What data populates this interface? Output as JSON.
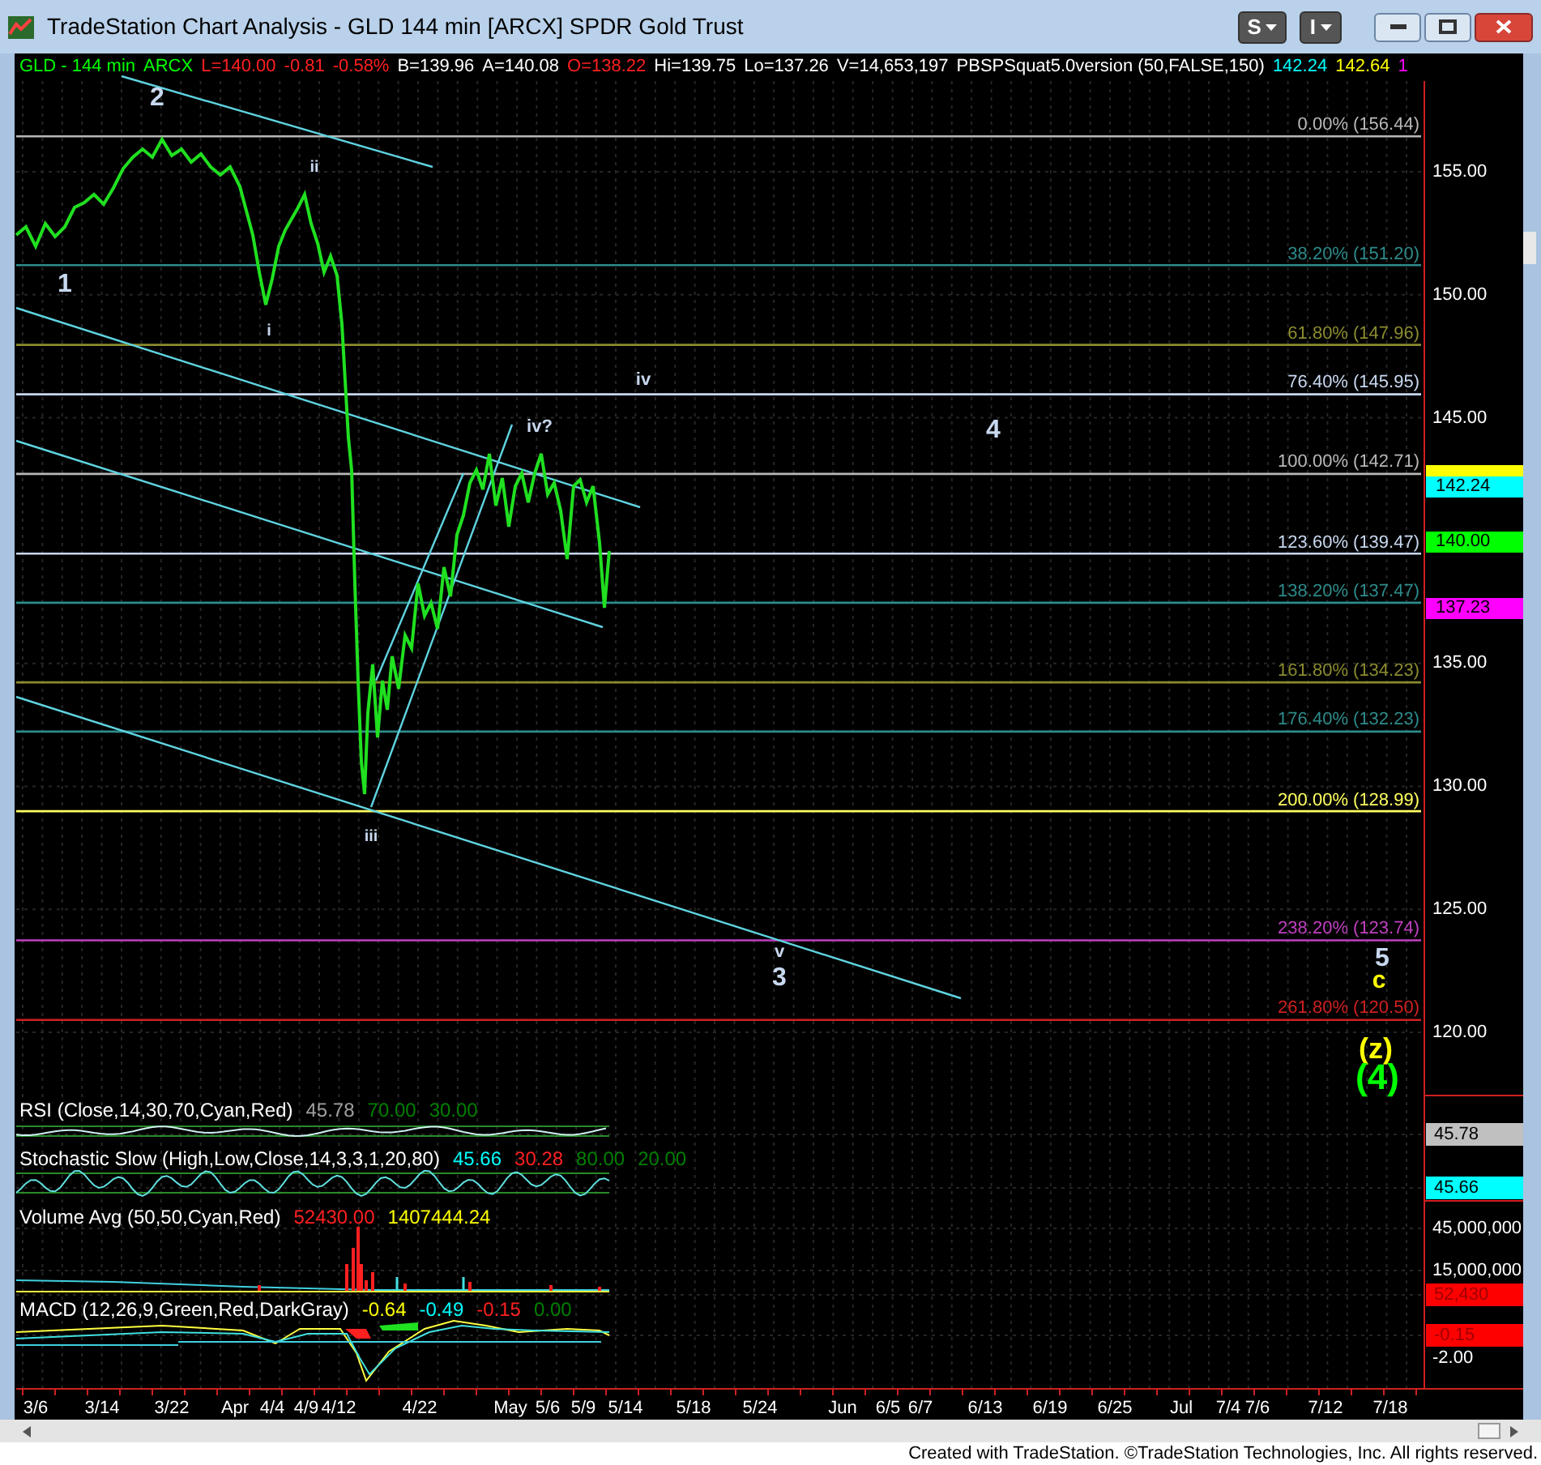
{
  "window": {
    "title": "TradeStation Chart Analysis - GLD 144 min [ARCX] SPDR Gold Trust"
  },
  "toolbar_buttons": [
    {
      "label": "S"
    },
    {
      "label": "I"
    }
  ],
  "header": [
    {
      "text": "GLD - 144 min",
      "color": "#00ff00"
    },
    {
      "text": "ARCX",
      "color": "#00ff00"
    },
    {
      "text": "L=140.00",
      "color": "#ff2020"
    },
    {
      "text": "-0.81",
      "color": "#ff2020"
    },
    {
      "text": "-0.58%",
      "color": "#ff2020"
    },
    {
      "text": "B=139.96",
      "color": "#ffffff"
    },
    {
      "text": "A=140.08",
      "color": "#ffffff"
    },
    {
      "text": "O=138.22",
      "color": "#ff2020"
    },
    {
      "text": "Hi=139.75",
      "color": "#ffffff"
    },
    {
      "text": "Lo=137.26",
      "color": "#ffffff"
    },
    {
      "text": "V=14,653,197",
      "color": "#ffffff"
    },
    {
      "text": "PBSPSquat5.0version (50,FALSE,150)",
      "color": "#ffffff"
    },
    {
      "text": "142.24",
      "color": "#00ffff"
    },
    {
      "text": "142.64",
      "color": "#ffff00"
    },
    {
      "text": "1",
      "color": "#ff00ff"
    }
  ],
  "fib_levels": [
    {
      "label": "0.00% (156.44)",
      "color": "#b8b8b8"
    },
    {
      "label": "38.20% (151.20)",
      "color": "#2e8b8b"
    },
    {
      "label": "61.80% (147.96)",
      "color": "#8b8b30"
    },
    {
      "label": "76.40% (145.95)",
      "color": "#c8d8f0"
    },
    {
      "label": "100.00% (142.71)",
      "color": "#b8b8b8"
    },
    {
      "label": "123.60% (139.47)",
      "color": "#c8d8f0"
    },
    {
      "label": "138.20% (137.47)",
      "color": "#2e8b8b"
    },
    {
      "label": "161.80% (134.23)",
      "color": "#8b8b30"
    },
    {
      "label": "176.40% (132.23)",
      "color": "#2e8b8b"
    },
    {
      "label": "200.00% (128.99)",
      "color": "#ffff60"
    },
    {
      "label": "238.20% (123.74)",
      "color": "#c040c0"
    },
    {
      "label": "261.80% (120.50)",
      "color": "#d02020"
    }
  ],
  "wave_labels": [
    {
      "text": "2",
      "color": "#c8d8f0"
    },
    {
      "text": "1",
      "color": "#c8d8f0"
    },
    {
      "text": "ii",
      "color": "#c8d8f0"
    },
    {
      "text": "i",
      "color": "#c8d8f0"
    },
    {
      "text": "iv",
      "color": "#c8d8f0"
    },
    {
      "text": "iv?",
      "color": "#c8d8f0"
    },
    {
      "text": "4",
      "color": "#c8d8f0"
    },
    {
      "text": "iii",
      "color": "#c8d8f0"
    },
    {
      "text": "v",
      "color": "#c8d8f0"
    },
    {
      "text": "3",
      "color": "#c8d8f0"
    },
    {
      "text": "5",
      "color": "#c8d8f0"
    },
    {
      "text": "c",
      "color": "#ffff00"
    },
    {
      "text": "(z)",
      "color": "#ffff00"
    },
    {
      "text": "(4)",
      "color": "#00ff00"
    }
  ],
  "price_axis": [
    "155.00",
    "150.00",
    "145.00",
    "135.00",
    "130.00",
    "125.00",
    "120.00"
  ],
  "price_markers": [
    {
      "color": "#ffff00"
    },
    {
      "text": "142.24",
      "color": "#00ffff"
    },
    {
      "text": "140.00",
      "color": "#00ff00"
    },
    {
      "text": "137.23",
      "color": "#ff00ff"
    }
  ],
  "indicators": [
    {
      "name": "RSI (Close,14,30,70,Cyan,Red)",
      "values": [
        {
          "text": "45.78",
          "color": "#a0a0a0"
        },
        {
          "text": "70.00",
          "color": "#008000"
        },
        {
          "text": "30.00",
          "color": "#008000"
        }
      ]
    },
    {
      "name": "Stochastic Slow (High,Low,Close,14,3,3,1,20,80)",
      "values": [
        {
          "text": "45.66",
          "color": "#00ffff"
        },
        {
          "text": "30.28",
          "color": "#ff2020"
        },
        {
          "text": "80.00",
          "color": "#008000"
        },
        {
          "text": "20.00",
          "color": "#008000"
        }
      ]
    },
    {
      "name": "Volume Avg (50,50,Cyan,Red)",
      "values": [
        {
          "text": "52430.00",
          "color": "#ff2020"
        },
        {
          "text": "1407444.24",
          "color": "#ffff00"
        }
      ]
    },
    {
      "name": "MACD (12,26,9,Green,Red,DarkGray)",
      "values": [
        {
          "text": "-0.64",
          "color": "#ffff00"
        },
        {
          "text": "-0.49",
          "color": "#00ffff"
        },
        {
          "text": "-0.15",
          "color": "#ff2020"
        },
        {
          "text": "0.00",
          "color": "#008000"
        }
      ]
    }
  ],
  "indicator_axis": [
    {
      "text": "45.78",
      "kind": "badge",
      "color": "#c0c0c0"
    },
    {
      "text": "45.66",
      "kind": "badge",
      "color": "#00ffff"
    },
    {
      "text": "45,000,000",
      "kind": "label"
    },
    {
      "text": "15,000,000",
      "kind": "label"
    },
    {
      "text": "52,430",
      "kind": "badge",
      "color": "#ff0000"
    },
    {
      "text": "-0.15",
      "kind": "badge",
      "color": "#ff0000"
    },
    {
      "text": "-2.00",
      "kind": "label"
    }
  ],
  "date_axis": [
    "3/6",
    "3/14",
    "3/22",
    "Apr",
    "4/4",
    "4/9",
    "4/12",
    "4/22",
    "May",
    "5/6",
    "5/9",
    "5/14",
    "5/18",
    "5/24",
    "Jun",
    "6/5",
    "6/7",
    "6/13",
    "6/19",
    "6/25",
    "Jul",
    "7/4",
    "7/6",
    "7/12",
    "7/18"
  ],
  "footer": "Created with TradeStation. ©TradeStation Technologies, Inc. All rights reserved."
}
